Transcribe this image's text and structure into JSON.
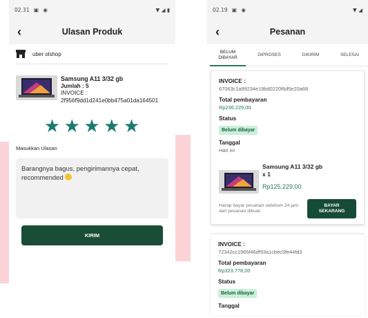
{
  "left": {
    "status": {
      "time": "02.31",
      "icons": [
        "image-icon",
        "at-icon"
      ],
      "right_icons": [
        "wifi-icon",
        "signal-icon",
        "battery-icon"
      ]
    },
    "title": "Ulasan Produk",
    "shop_name": "uber olshop",
    "product": {
      "name": "Samsung A11 3/32 gb",
      "qty": "Jumlah : 5",
      "invoice": "INVOICE : 2f956f9dd1d241e0bb475a01da164501"
    },
    "rating": [
      "★",
      "★",
      "★",
      "★",
      "★"
    ],
    "review_label": "Masukkan Ulasan",
    "review_text": "Barangnya bagus, pengirimannya cepat, recommended",
    "submit_label": "KIRIM"
  },
  "right": {
    "status": {
      "time": "02.19",
      "icons": [
        "image-icon",
        "at-icon"
      ],
      "right_icons": [
        "wifi-icon",
        "signal-icon",
        "battery-icon"
      ]
    },
    "title": "Pesanan",
    "tabs": {
      "belum_line1": "BELUM",
      "belum_line2": "DIBAYAR",
      "diproses": "DIPROSES",
      "dikirim": "DIKIRIM",
      "selesai": "SELESAI"
    },
    "order1": {
      "invoice_label": "INVOICE :",
      "invoice": "67063c1a99234e19bd0220f6d5e20a68",
      "total_label": "Total pembayaran",
      "total": "Rp236.229,00",
      "status_label": "Status",
      "status": "Belum dibayar",
      "date_label": "Tanggal",
      "date": "Hari ini",
      "item_name": "Samsung A11 3/32 gb",
      "item_qty": "x 1",
      "item_price": "Rp125.229,00",
      "note": "Harap bayar pesanan sebelum 24 jam dari pesanan dibuat.",
      "pay_line1": "BAYAR",
      "pay_line2": "SEKARANG"
    },
    "order2": {
      "invoice_label": "INVOICE :",
      "invoice": "72342cc1965f46df93a1cbec5fe44fd3",
      "total_label": "Total pembayaran",
      "total": "Rp323.778,00",
      "status_label": "Status",
      "status": "Belum dibayar",
      "date_label": "Tanggal"
    }
  }
}
